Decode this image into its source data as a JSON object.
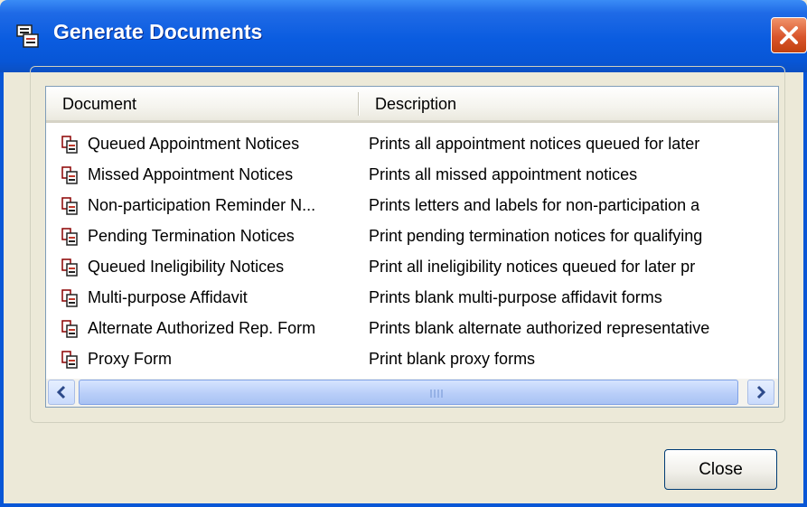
{
  "window": {
    "title": "Generate Documents",
    "app_icon": "printer-app-icon",
    "close_icon": "close-x-icon"
  },
  "list": {
    "columns": [
      "Document",
      "Description"
    ],
    "rows": [
      {
        "document": "Queued Appointment Notices",
        "description": "Prints all appointment notices queued for later"
      },
      {
        "document": "Missed Appointment Notices",
        "description": "Prints all missed appointment notices"
      },
      {
        "document": "Non-participation Reminder N...",
        "description": "Prints letters and labels for non-participation a"
      },
      {
        "document": "Pending Termination Notices",
        "description": "Print pending termination notices for qualifying"
      },
      {
        "document": "Queued Ineligibility Notices",
        "description": "Print all ineligibility notices queued for later pr"
      },
      {
        "document": "Multi-purpose Affidavit",
        "description": "Prints blank multi-purpose affidavit forms"
      },
      {
        "document": "Alternate Authorized Rep. Form",
        "description": "Prints blank alternate authorized representative"
      },
      {
        "document": "Proxy Form",
        "description": "Print blank proxy forms"
      }
    ],
    "row_icon": "document-print-icon"
  },
  "buttons": {
    "close_label": "Close"
  },
  "colors": {
    "titlebar": "#0856d6",
    "dialog_bg": "#ece9d8",
    "close_red": "#d9552c",
    "scroll_thumb": "#b7cdf8"
  }
}
